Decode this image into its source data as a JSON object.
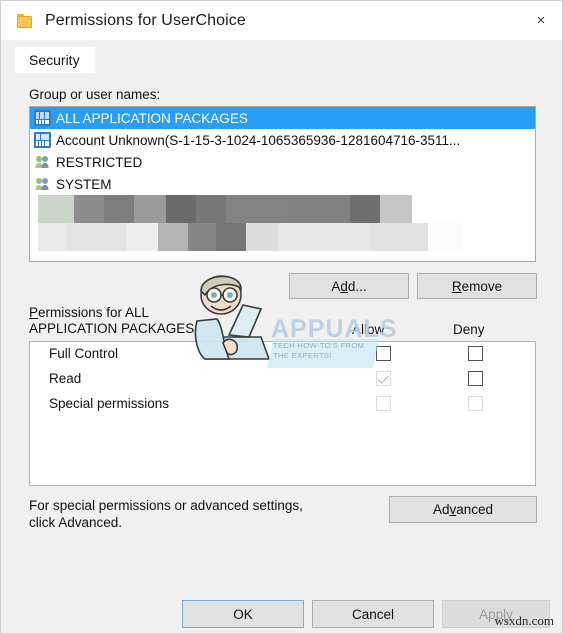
{
  "window": {
    "title": "Permissions for UserChoice",
    "icon": "folder-icon",
    "close_label": "×"
  },
  "tabs": [
    {
      "label": "Security",
      "active": true
    }
  ],
  "group_section": {
    "label": "Group or user names:",
    "items": [
      {
        "name": "ALL APPLICATION PACKAGES",
        "icon": "app-package-icon",
        "selected": true
      },
      {
        "name": "Account Unknown(S-1-15-3-1024-1065365936-1281604716-3511...",
        "icon": "app-package-icon",
        "selected": false
      },
      {
        "name": "RESTRICTED",
        "icon": "user-group-icon",
        "selected": false
      },
      {
        "name": "SYSTEM",
        "icon": "user-group-icon",
        "selected": false
      }
    ],
    "redacted_rows": 2
  },
  "actions": {
    "add_label": "Add...",
    "add_accel": "d",
    "remove_label": "Remove",
    "remove_accel": "R"
  },
  "permissions_section": {
    "label_line1": "Permissions for ALL",
    "label_line2": "APPLICATION PACKAGES",
    "label_accel": "P",
    "columns": [
      "Allow",
      "Deny"
    ],
    "rows": [
      {
        "name": "Full Control",
        "allow": {
          "checked": false,
          "disabled": false
        },
        "deny": {
          "checked": false,
          "disabled": false
        }
      },
      {
        "name": "Read",
        "allow": {
          "checked": true,
          "disabled": true
        },
        "deny": {
          "checked": false,
          "disabled": false
        }
      },
      {
        "name": "Special permissions",
        "allow": {
          "checked": false,
          "disabled": true
        },
        "deny": {
          "checked": false,
          "disabled": true
        }
      }
    ]
  },
  "advanced_section": {
    "text_line1": "For special permissions or advanced settings,",
    "text_line2": "click Advanced.",
    "button_label": "Advanced",
    "button_accel": "v"
  },
  "footer": {
    "ok_label": "OK",
    "cancel_label": "Cancel",
    "apply_label": "Apply",
    "apply_disabled": true
  },
  "watermarks": {
    "appuals_title": "APPUALS",
    "appuals_sub_line1": "TECH HOW-TO'S FROM",
    "appuals_sub_line2": "THE EXPERTS!",
    "site": "wsxdn.com"
  },
  "colors": {
    "selection_blue": "#2a9df4",
    "panel_gray": "#f0f0f0",
    "button_face": "#e1e1e1",
    "focus_border": "#7eadd1",
    "folder_yellow": "#f4c550"
  }
}
